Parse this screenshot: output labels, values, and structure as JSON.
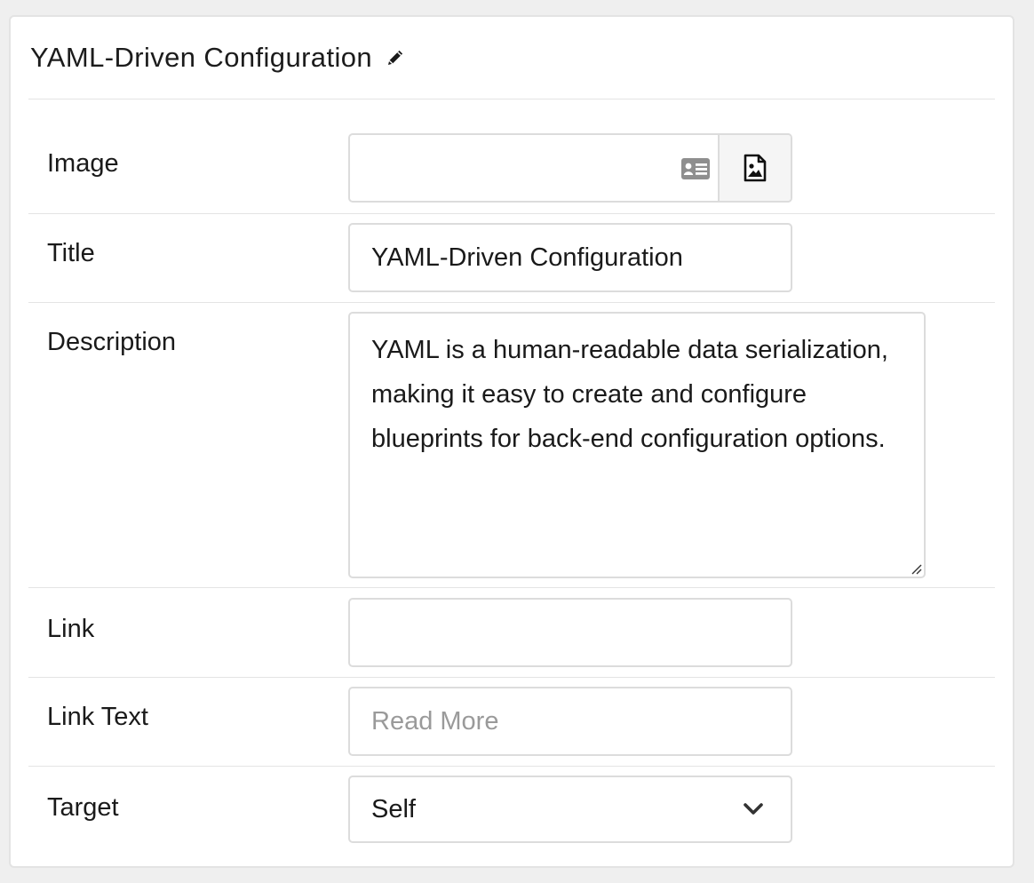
{
  "panel": {
    "title": "YAML-Driven Configuration",
    "edit_icon": "pencil-icon"
  },
  "fields": {
    "image": {
      "label": "Image",
      "value": "",
      "icons": [
        "id-card-icon",
        "image-file-icon"
      ]
    },
    "title": {
      "label": "Title",
      "value": "YAML-Driven Configuration"
    },
    "description": {
      "label": "Description",
      "value": "YAML is a human-readable data serialization, making it easy to create and configure blueprints for back-end configuration options."
    },
    "link": {
      "label": "Link",
      "value": ""
    },
    "link_text": {
      "label": "Link Text",
      "value": "",
      "placeholder": "Read More"
    },
    "target": {
      "label": "Target",
      "selected": "Self"
    }
  },
  "colors": {
    "background": "#efefef",
    "panel": "#ffffff",
    "border": "#dcdcdc",
    "placeholder": "#9a9a9a"
  }
}
